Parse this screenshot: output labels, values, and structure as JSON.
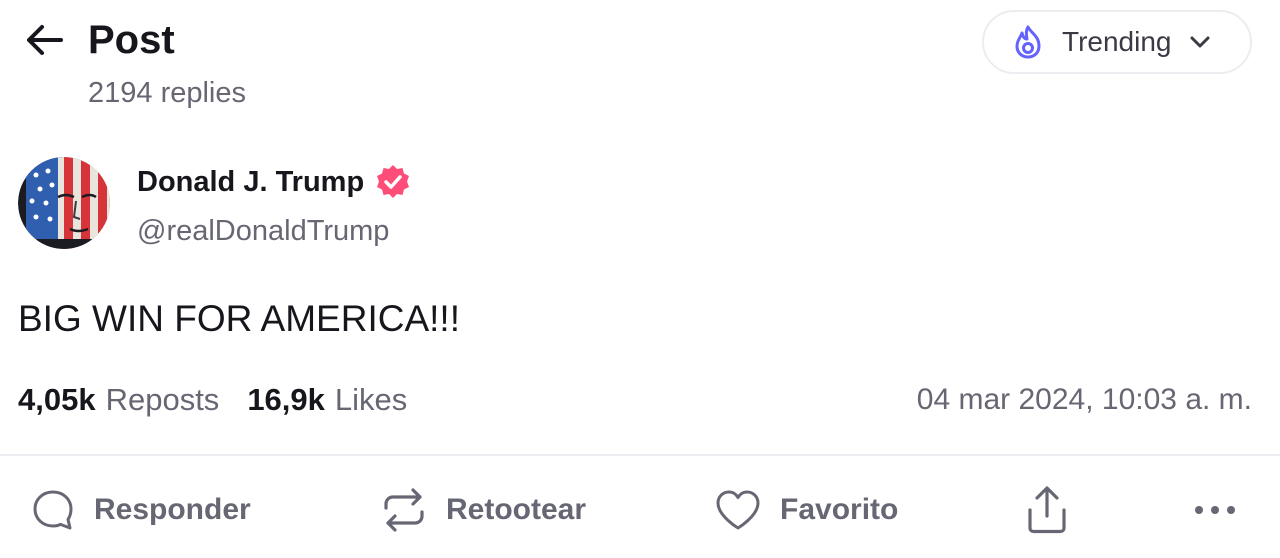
{
  "header": {
    "title": "Post",
    "reply_count": "2194 replies",
    "sort": {
      "selected": "Trending",
      "icon": "flame-icon"
    }
  },
  "post": {
    "author": {
      "name": "Donald J. Trump",
      "handle": "@realDonaldTrump",
      "verified": true
    },
    "text": "BIG WIN FOR AMERICA!!!",
    "stats": {
      "reposts_count": "4,05k",
      "reposts_label": "Reposts",
      "likes_count": "16,9k",
      "likes_label": "Likes"
    },
    "timestamp": "04 mar 2024, 10:03 a. m."
  },
  "actions": {
    "reply_label": "Responder",
    "boost_label": "Retootear",
    "favorite_label": "Favorito"
  },
  "colors": {
    "accent": "#6363ff",
    "verified": "#ff4d79",
    "text_primary": "#16161d",
    "text_secondary": "#676774",
    "divider": "#ececf1"
  }
}
